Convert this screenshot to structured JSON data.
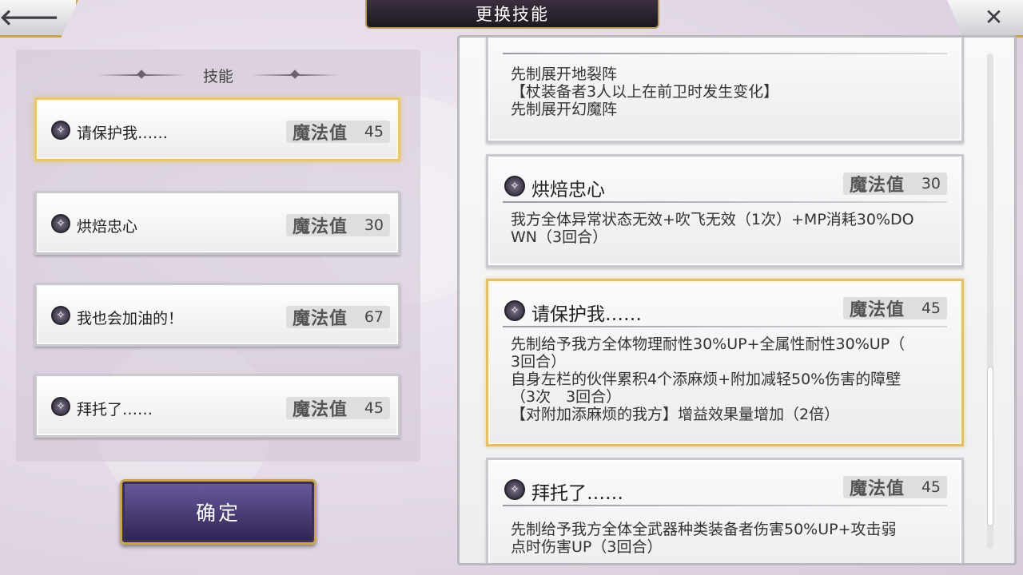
{
  "header": {
    "title": "更换技能",
    "back_icon": "arrow-left-icon",
    "close_icon": "close-x-icon"
  },
  "left_panel": {
    "section_title": "技能",
    "skills": [
      {
        "name": "请保护我……",
        "mp_label": "魔法值",
        "mp": "45",
        "selected": true
      },
      {
        "name": "烘焙忠心",
        "mp_label": "魔法值",
        "mp": "30",
        "selected": false
      },
      {
        "name": "我也会加油的！",
        "mp_label": "魔法值",
        "mp": "67",
        "selected": false
      },
      {
        "name": "拜托了……",
        "mp_label": "魔法值",
        "mp": "45",
        "selected": false
      }
    ],
    "confirm_label": "确定"
  },
  "detail_panel": {
    "cards": [
      {
        "name": "",
        "mp_label": "",
        "mp": "",
        "desc": "先制展开地裂阵\n【杖装备者3人以上在前卫时发生变化】\n先制展开幻魔阵"
      },
      {
        "name": "烘焙忠心",
        "mp_label": "魔法值",
        "mp": "30",
        "desc": "我方全体异常状态无效+吹飞无效（1次）+MP消耗30%DO\nWN（3回合）"
      },
      {
        "name": "请保护我……",
        "mp_label": "魔法值",
        "mp": "45",
        "desc": "先制给予我方全体物理耐性30%UP+全属性耐性30%UP（\n3回合）\n自身左栏的伙伴累积4个添麻烦+附加减轻50%伤害的障壁\n（3次　3回合）\n【对附加添麻烦的我方】增益效果量增加（2倍）"
      },
      {
        "name": "拜托了……",
        "mp_label": "魔法值",
        "mp": "45",
        "desc": "先制给予我方全体全武器种类装备者伤害50%UP+攻击弱\n点时伤害UP（3回合）"
      }
    ]
  },
  "colors": {
    "selected_border": "#e9c86c",
    "confirm_bg": "#3d3068",
    "title_bg": "#2a2230"
  },
  "skill_icon_name": "skill-emblem-icon"
}
